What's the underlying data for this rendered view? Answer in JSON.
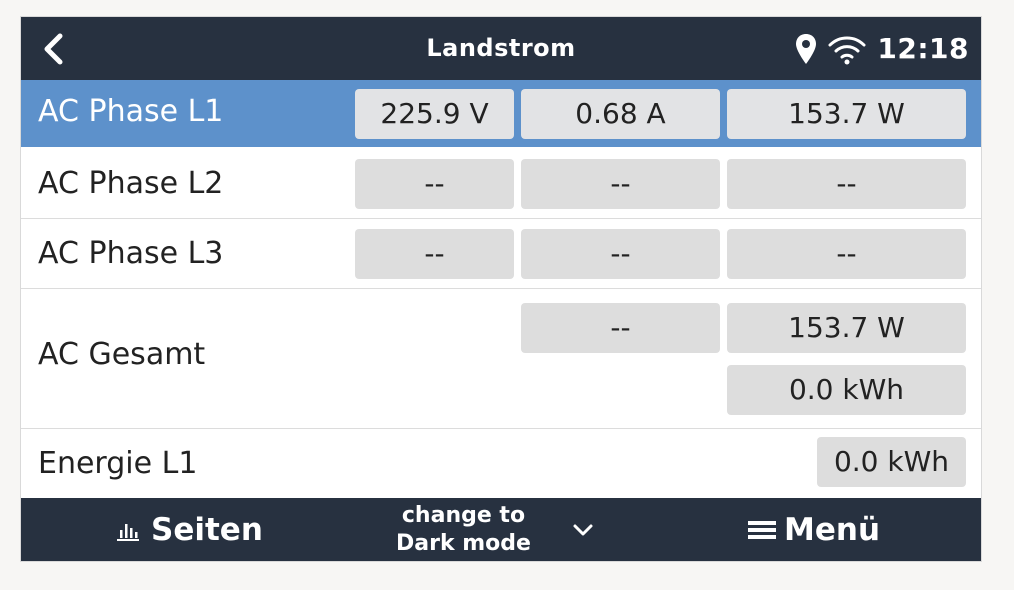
{
  "header": {
    "title": "Landstrom",
    "clock": "12:18",
    "icons": [
      "back-chevron-icon",
      "location-pin-icon",
      "wifi-icon"
    ]
  },
  "rows": [
    {
      "label": "AC Phase L1",
      "voltage": "225.9 V",
      "current": "0.68 A",
      "power": "153.7 W",
      "selected": true
    },
    {
      "label": "AC Phase L2",
      "voltage": "--",
      "current": "--",
      "power": "--"
    },
    {
      "label": "AC Phase L3",
      "voltage": "--",
      "current": "--",
      "power": "--"
    }
  ],
  "total": {
    "label": "AC Gesamt",
    "current": "--",
    "power": "153.7 W",
    "energy": "0.0 kWh"
  },
  "energy_l1": {
    "label": "Energie L1",
    "value": "0.0 kWh"
  },
  "footer": {
    "pages_label": "Seiten",
    "dark_mode_line1": "change to",
    "dark_mode_line2": "Dark mode",
    "menu_label": "Menü",
    "icons": [
      "bar-chart-icon",
      "chevron-down-icon",
      "hamburger-menu-icon"
    ]
  },
  "colors": {
    "topbar": "#273140",
    "selected_row": "#5d91cb",
    "cell": "#dddddd",
    "background": "#f7f6f4"
  }
}
